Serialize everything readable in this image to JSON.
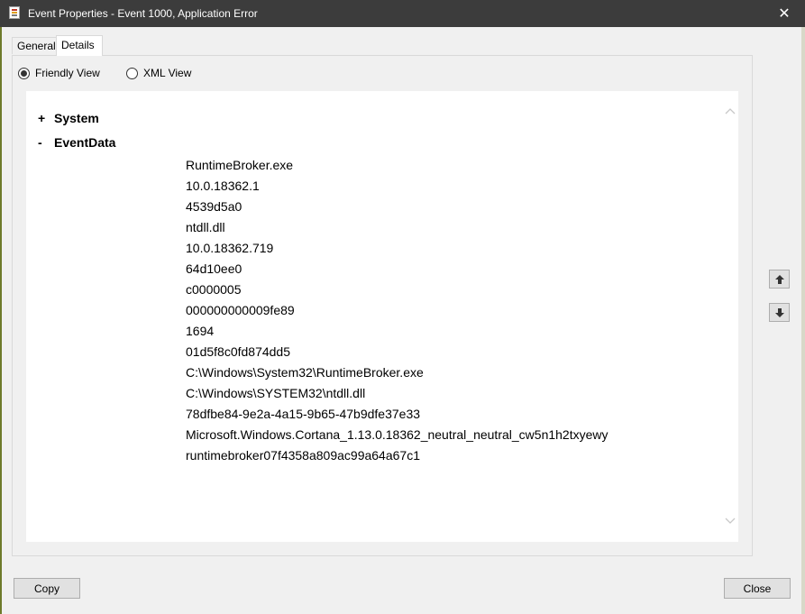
{
  "window": {
    "title": "Event Properties - Event 1000, Application Error",
    "close_glyph": "✕"
  },
  "tabs": [
    {
      "label": "General"
    },
    {
      "label": "Details"
    }
  ],
  "view_options": {
    "friendly_label": "Friendly View",
    "xml_label": "XML View",
    "selected": "Friendly View"
  },
  "tree": {
    "system": {
      "sign": "+",
      "label": "System"
    },
    "event_data": {
      "sign": "-",
      "label": "EventData"
    }
  },
  "event_values": [
    "RuntimeBroker.exe",
    "10.0.18362.1",
    "4539d5a0",
    "ntdll.dll",
    "10.0.18362.719",
    "64d10ee0",
    "c0000005",
    "000000000009fe89",
    "1694",
    "01d5f8c0fd874dd5",
    "C:\\Windows\\System32\\RuntimeBroker.exe",
    "C:\\Windows\\SYSTEM32\\ntdll.dll",
    "78dfbe84-9e2a-4a15-9b65-47b9dfe37e33",
    "Microsoft.Windows.Cortana_1.13.0.18362_neutral_neutral_cw5n1h2txyewy",
    "runtimebroker07f4358a809ac99a64a67c1"
  ],
  "buttons": {
    "copy": "Copy",
    "close": "Close"
  },
  "icons": {
    "previous_event": "arrow-up-icon",
    "next_event": "arrow-down-icon",
    "scroll_up": "chevron-up-icon",
    "scroll_down": "chevron-down-icon"
  }
}
